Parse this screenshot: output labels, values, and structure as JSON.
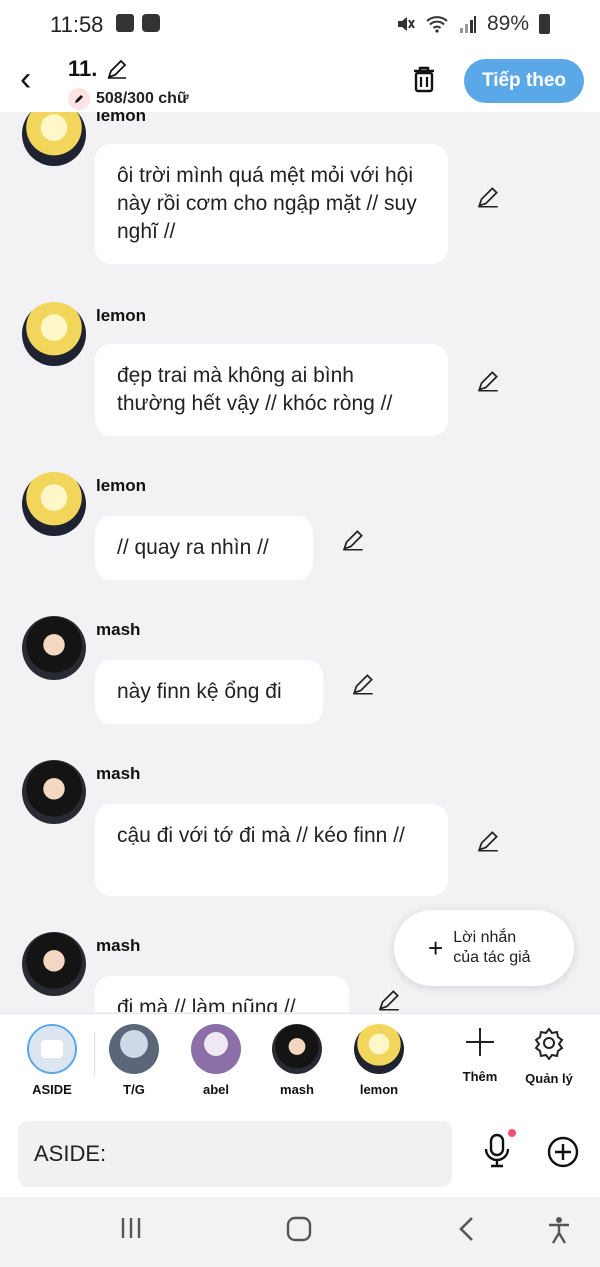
{
  "status": {
    "time": "11:58",
    "battery": "89%"
  },
  "header": {
    "title": "11.",
    "word_count": "508/300 chữ",
    "next_label": "Tiếp theo"
  },
  "messages": [
    {
      "speaker": "lemon",
      "text": "ôi trời mình quá mệt mỏi với hội này rồi cơm cho ngập mặt // suy nghĩ //"
    },
    {
      "speaker": "lemon",
      "text": "đẹp trai mà không ai bình thường hết vậy // khóc ròng //"
    },
    {
      "speaker": "lemon",
      "text": "// quay ra nhìn //"
    },
    {
      "speaker": "mash",
      "text": "này finn kệ ổng đi"
    },
    {
      "speaker": "mash",
      "text": "cậu đi với tớ đi mà // kéo finn //"
    },
    {
      "speaker": "mash",
      "text": "đi mà // làm nũng //"
    }
  ],
  "author_note": {
    "line1": "Lời nhắn",
    "line2": "của tác giả"
  },
  "characters": [
    {
      "label": "ASIDE"
    },
    {
      "label": "T/G"
    },
    {
      "label": "abel"
    },
    {
      "label": "mash"
    },
    {
      "label": "lemon"
    }
  ],
  "tools": {
    "add_label": "Thêm",
    "manage_label": "Quản lý"
  },
  "input": {
    "placeholder": "ASIDE:"
  }
}
